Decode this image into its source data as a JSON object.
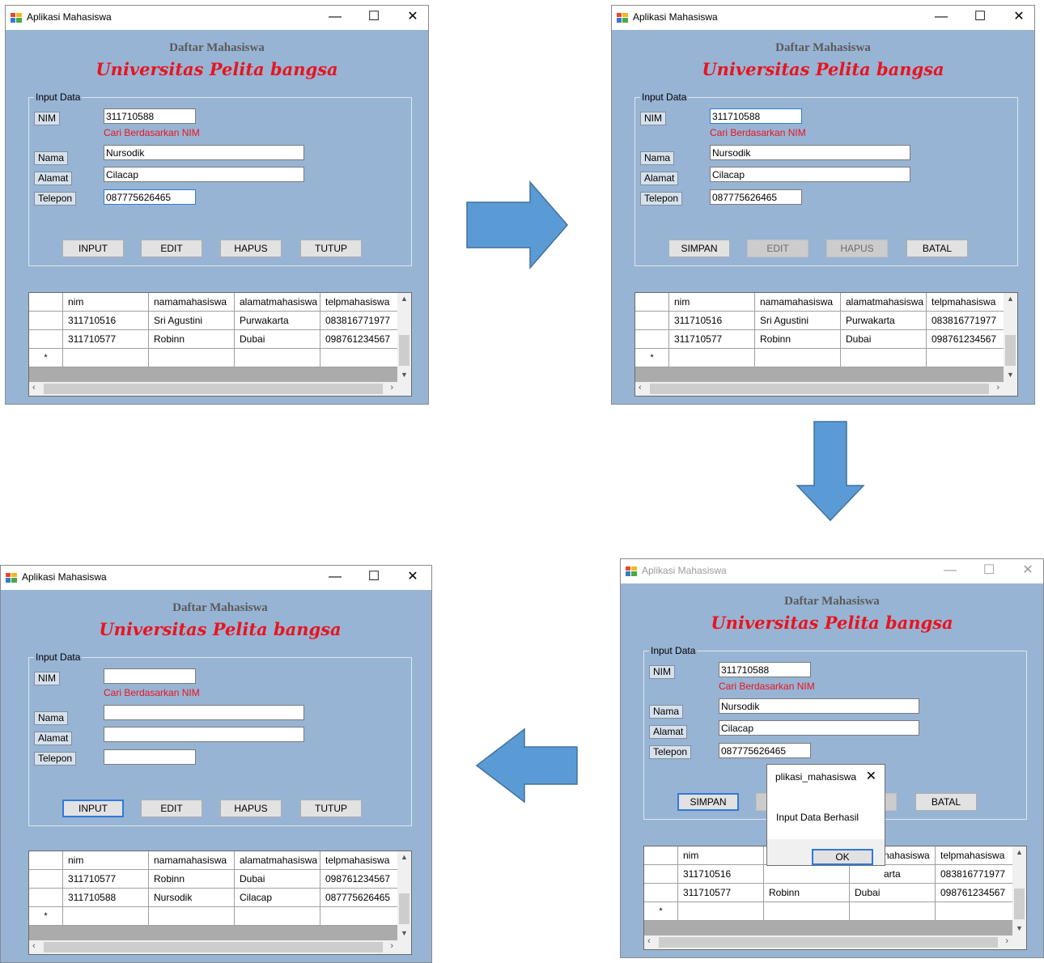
{
  "app": {
    "title": "Aplikasi Mahasiswa",
    "heading": "Daftar Mahasiswa",
    "subheading": "Universitas Pelita bangsa"
  },
  "labels": {
    "group": "Input Data",
    "nim": "NIM",
    "nama": "Nama",
    "alamat": "Alamat",
    "telepon": "Telepon",
    "hint": "Cari Berdasarkan NIM"
  },
  "grid_headers": [
    "nim",
    "namamahasiswa",
    "alamatmahasiswa",
    "telpmahasiswa"
  ],
  "new_row_marker": "*",
  "window_controls": {
    "minimize": "—",
    "maximize": "☐",
    "close": "✕"
  },
  "screens": [
    {
      "fields": {
        "nim": "311710588",
        "nama": "Nursodik",
        "alamat": "Cilacap",
        "telepon": "087775626465"
      },
      "buttons": [
        "INPUT",
        "EDIT",
        "HAPUS",
        "TUTUP"
      ],
      "rows": [
        [
          "311710516",
          "Sri Agustini",
          "Purwakarta",
          "083816771977"
        ],
        [
          "311710577",
          "Robinn",
          "Dubai",
          "098761234567"
        ]
      ]
    },
    {
      "fields": {
        "nim": "311710588",
        "nama": "Nursodik",
        "alamat": "Cilacap",
        "telepon": "087775626465"
      },
      "buttons": [
        "SIMPAN",
        "EDIT",
        "HAPUS",
        "BATAL"
      ],
      "rows": [
        [
          "311710516",
          "Sri Agustini",
          "Purwakarta",
          "083816771977"
        ],
        [
          "311710577",
          "Robinn",
          "Dubai",
          "098761234567"
        ]
      ]
    },
    {
      "fields": {
        "nim": "311710588",
        "nama": "Nursodik",
        "alamat": "Cilacap",
        "telepon": "087775626465"
      },
      "buttons": [
        "SIMPAN",
        "",
        "",
        "BATAL"
      ],
      "rows": [
        [
          "311710516",
          "",
          "",
          "083816771977"
        ],
        [
          "311710577",
          "Robinn",
          "Dubai",
          "098761234567"
        ]
      ],
      "dialog": {
        "title": "plikasi_mahasiswa",
        "message": "Input Data Berhasil",
        "ok": "OK",
        "close": "✕",
        "partial_header": "nahasiswa",
        "partial_cell": "arta"
      }
    },
    {
      "fields": {
        "nim": "",
        "nama": "",
        "alamat": "",
        "telepon": ""
      },
      "buttons": [
        "INPUT",
        "EDIT",
        "HAPUS",
        "TUTUP"
      ],
      "rows": [
        [
          "311710577",
          "Robinn",
          "Dubai",
          "098761234567"
        ],
        [
          "311710588",
          "Nursodik",
          "Cilacap",
          "087775626465"
        ]
      ]
    }
  ],
  "colors": {
    "window_bg": "#98b4d4",
    "accent_red": "#e8141e",
    "arrow_fill": "#5b9bd5",
    "arrow_stroke": "#41719c"
  }
}
